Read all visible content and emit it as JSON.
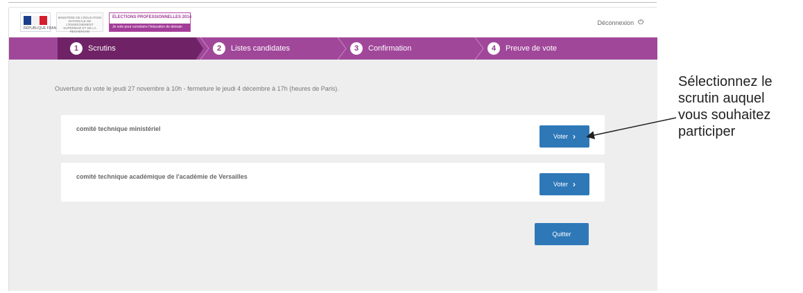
{
  "header": {
    "logo_text": "RÉPUBLIQUE FRANÇAISE",
    "ministry_text": "MINISTÈRE DE L'ÉDUCATION NATIONALE DE L'ENSEIGNEMENT SUPÉRIEUR ET DE LA RECHERCHE",
    "election_title": "ÉLECTIONS PROFESSIONNELLES 2014",
    "election_subtitle": "Je vote pour construire l'éducation de demain",
    "logout_label": "Déconnexion",
    "logout_icon": "power-icon"
  },
  "steps": [
    {
      "number": "1",
      "label": "Scrutins",
      "active": true
    },
    {
      "number": "2",
      "label": "Listes candidates",
      "active": false
    },
    {
      "number": "3",
      "label": "Confirmation",
      "active": false
    },
    {
      "number": "4",
      "label": "Preuve de vote",
      "active": false
    }
  ],
  "main": {
    "intro": "Ouverture du vote le jeudi 27 novembre à 10h - fermeture le jeudi 4 décembre à 17h (heures de Paris).",
    "ballots": [
      {
        "title": "comité technique ministériel",
        "button_label": "Voter"
      },
      {
        "title": "comité technique académique de l'académie de Versailles",
        "button_label": "Voter"
      }
    ],
    "quit_label": "Quitter"
  },
  "annotation": {
    "lines": [
      "Sélectionnez le",
      "scrutin auquel",
      "vous souhaitez",
      "participer"
    ]
  },
  "colors": {
    "stepper_bg": "#a0479a",
    "stepper_active": "#6f2366",
    "button": "#2e78b8",
    "background": "#eeeeef"
  }
}
